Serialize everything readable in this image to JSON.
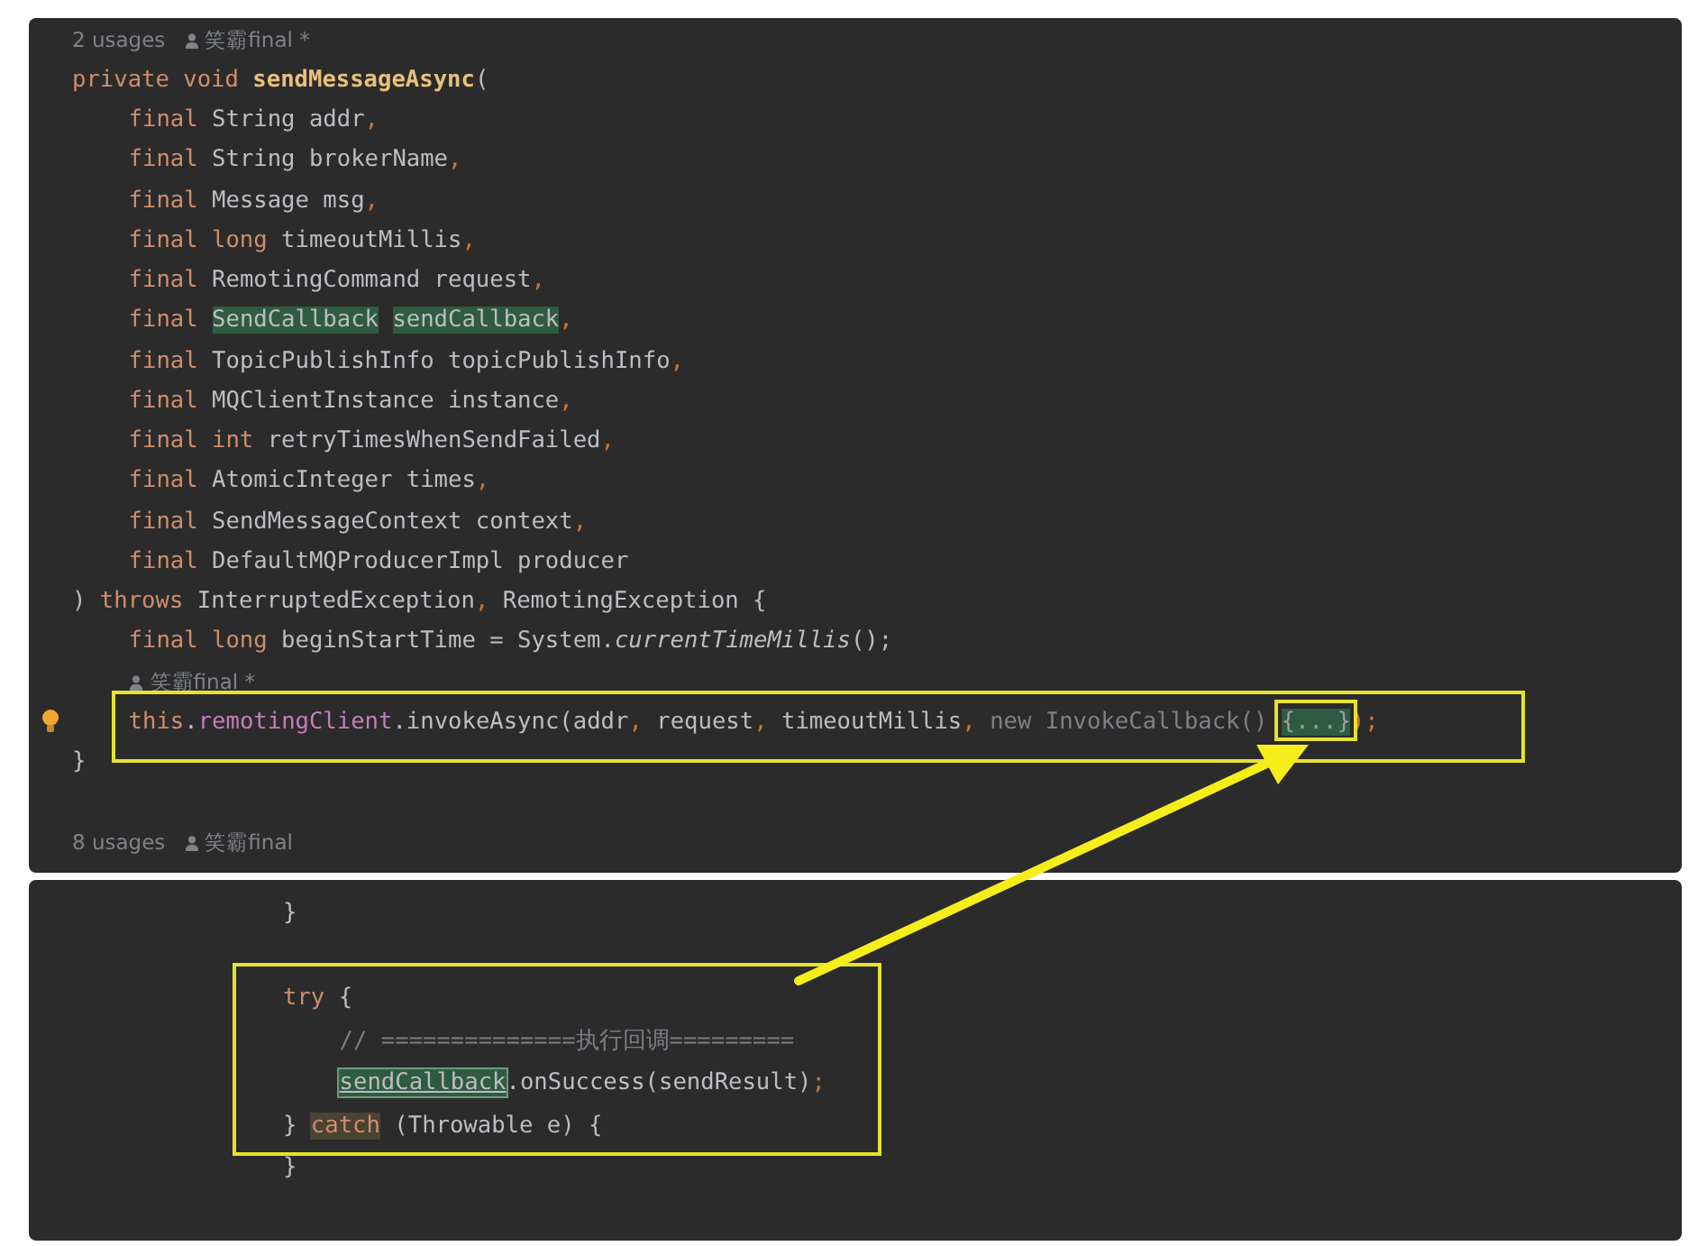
{
  "panels": [
    {
      "lines": [
        {
          "kind": "hint",
          "usages": "2 usages",
          "author": "笑霸final *"
        },
        {
          "kind": "code",
          "tokens": [
            {
              "kind": "keyword",
              "text": "private void "
            },
            {
              "kind": "method",
              "text": "sendMessageAsync"
            },
            {
              "kind": "plain",
              "text": "("
            }
          ],
          "children": [
            {
              "kind": "code",
              "tokens": [
                {
                  "kind": "keyword",
                  "text": "final "
                },
                {
                  "kind": "plain",
                  "text": "String addr"
                },
                {
                  "kind": "comma",
                  "text": ","
                }
              ]
            },
            {
              "kind": "code",
              "tokens": [
                {
                  "kind": "keyword",
                  "text": "final "
                },
                {
                  "kind": "plain",
                  "text": "String brokerName"
                },
                {
                  "kind": "comma",
                  "text": ","
                }
              ]
            },
            {
              "kind": "code",
              "tokens": [
                {
                  "kind": "keyword",
                  "text": "final "
                },
                {
                  "kind": "plain",
                  "text": "Message msg"
                },
                {
                  "kind": "comma",
                  "text": ","
                }
              ]
            },
            {
              "kind": "code",
              "tokens": [
                {
                  "kind": "keyword",
                  "text": "final long "
                },
                {
                  "kind": "plain",
                  "text": "timeoutMillis"
                },
                {
                  "kind": "comma",
                  "text": ","
                }
              ]
            },
            {
              "kind": "code",
              "tokens": [
                {
                  "kind": "keyword",
                  "text": "final "
                },
                {
                  "kind": "plain",
                  "text": "RemotingCommand request"
                },
                {
                  "kind": "comma",
                  "text": ","
                }
              ]
            },
            {
              "kind": "code",
              "tokens": [
                {
                  "kind": "keyword",
                  "text": "final "
                },
                {
                  "kind": "highlight",
                  "text": "SendCallback"
                },
                {
                  "kind": "highlight",
                  "text": "sendCallback"
                },
                {
                  "kind": "comma",
                  "text": ","
                }
              ]
            },
            {
              "kind": "code",
              "tokens": [
                {
                  "kind": "keyword",
                  "text": "final "
                },
                {
                  "kind": "plain",
                  "text": "TopicPublishInfo topicPublishInfo"
                },
                {
                  "kind": "comma",
                  "text": ","
                }
              ]
            },
            {
              "kind": "code",
              "tokens": [
                {
                  "kind": "keyword",
                  "text": "final "
                },
                {
                  "kind": "plain",
                  "text": "MQClientInstance instance"
                },
                {
                  "kind": "comma",
                  "text": ","
                }
              ]
            },
            {
              "kind": "code",
              "tokens": [
                {
                  "kind": "keyword",
                  "text": "final int "
                },
                {
                  "kind": "plain",
                  "text": "retryTimesWhenSendFailed"
                },
                {
                  "kind": "comma",
                  "text": ","
                }
              ]
            },
            {
              "kind": "code",
              "tokens": [
                {
                  "kind": "keyword",
                  "text": "final "
                },
                {
                  "kind": "plain",
                  "text": "AtomicInteger times"
                },
                {
                  "kind": "comma",
                  "text": ","
                }
              ]
            },
            {
              "kind": "code",
              "tokens": [
                {
                  "kind": "keyword",
                  "text": "final "
                },
                {
                  "kind": "plain",
                  "text": "SendMessageContext context"
                },
                {
                  "kind": "comma",
                  "text": ","
                }
              ]
            },
            {
              "kind": "code",
              "tokens": [
                {
                  "kind": "keyword",
                  "text": "final "
                },
                {
                  "kind": "plain",
                  "text": "DefaultMQProducerImpl producer"
                }
              ]
            }
          ]
        },
        {
          "kind": "code",
          "tokens": [
            {
              "kind": "plain",
              "text": ") "
            },
            {
              "kind": "keyword",
              "text": "throws "
            },
            {
              "kind": "plain",
              "text": "InterruptedException"
            },
            {
              "kind": "comma",
              "text": ", "
            },
            {
              "kind": "plain",
              "text": "RemotingException {"
            }
          ],
          "children": [
            {
              "kind": "code",
              "tokens": [
                {
                  "kind": "keyword",
                  "text": "final long "
                },
                {
                  "kind": "plain",
                  "text": "beginStartTime = System."
                },
                {
                  "kind": "italic",
                  "text": "currentTimeMillis"
                },
                {
                  "kind": "plain",
                  "text": "();"
                }
              ]
            },
            {
              "kind": "hint",
              "author": "笑霸final *"
            },
            {
              "kind": "intention",
              "tokens": [
                {
                  "kind": "keyword",
                  "text": "this"
                },
                {
                  "kind": "plain",
                  "text": "."
                },
                {
                  "kind": "field",
                  "text": "remotingClient"
                },
                {
                  "kind": "plain",
                  "text": ".invokeAsync(addr"
                },
                {
                  "kind": "comma",
                  "text": ", "
                },
                {
                  "kind": "plain",
                  "text": "request"
                },
                {
                  "kind": "comma",
                  "text": ", "
                },
                {
                  "kind": "plain",
                  "text": "timeoutMillis"
                },
                {
                  "kind": "comma",
                  "text": ", "
                },
                {
                  "kind": "dim",
                  "text": "new InvokeCallback() "
                },
                {
                  "kind": "fold",
                  "text": "{...}"
                },
                {
                  "kind": "comma",
                  "text": ");"
                }
              ]
            }
          ]
        },
        {
          "kind": "code",
          "tokens": [
            {
              "kind": "plain",
              "text": "}"
            }
          ]
        },
        {
          "kind": "blank"
        },
        {
          "kind": "hint",
          "usages": "8 usages",
          "author": "笑霸final"
        }
      ]
    },
    {
      "lines": [
        {
          "kind": "code",
          "tokens": [
            {
              "kind": "plain",
              "text": "}"
            }
          ]
        },
        {
          "kind": "blank"
        },
        {
          "kind": "code",
          "tokens": [
            {
              "kind": "keyword",
              "text": "try "
            },
            {
              "kind": "plain",
              "text": "{"
            }
          ],
          "children": [
            {
              "kind": "code",
              "tokens": [
                {
                  "kind": "comment",
                  "text": "// ==============执行回调========="
                }
              ]
            },
            {
              "kind": "code",
              "tokens": [
                {
                  "kind": "selected",
                  "text": "sendCallback"
                },
                {
                  "kind": "plain",
                  "text": ".onSuccess(sendResult)"
                },
                {
                  "kind": "comma",
                  "text": ";"
                }
              ]
            }
          ]
        },
        {
          "kind": "code",
          "tokens": [
            {
              "kind": "plain",
              "text": "} "
            },
            {
              "kind": "catch",
              "text": "catch"
            },
            {
              "kind": "plain",
              "text": " (Throwable e) {"
            }
          ]
        },
        {
          "kind": "code",
          "tokens": [
            {
              "kind": "plain",
              "text": "}"
            }
          ]
        }
      ]
    }
  ]
}
